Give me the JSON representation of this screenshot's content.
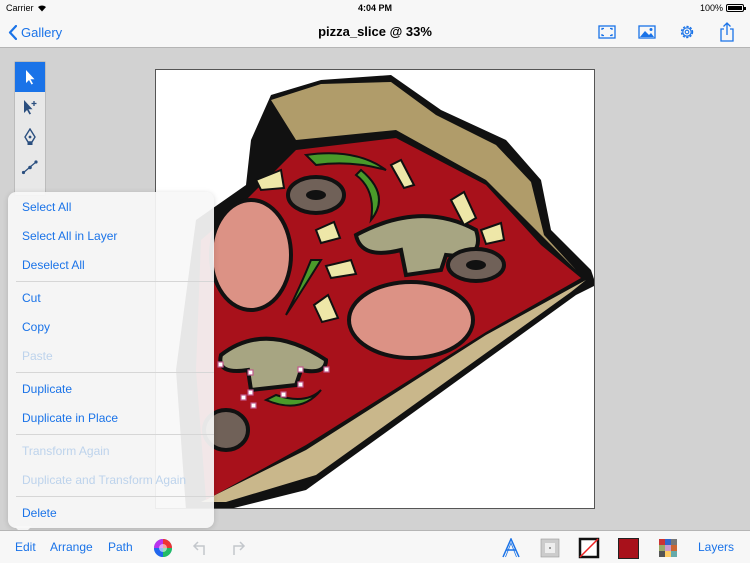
{
  "status_bar": {
    "carrier": "Carrier",
    "time": "4:04 PM",
    "battery": "100%"
  },
  "nav": {
    "back_label": "Gallery",
    "title": "pizza_slice @ 33%",
    "icons": [
      "fullscreen-icon",
      "image-icon",
      "settings-gear-icon",
      "share-icon"
    ]
  },
  "tools": [
    "select-arrow-icon",
    "direct-select-icon",
    "pen-icon",
    "node-edit-icon"
  ],
  "edit_menu": {
    "items": [
      {
        "label": "Select All",
        "enabled": true
      },
      {
        "label": "Select All in Layer",
        "enabled": true
      },
      {
        "label": "Deselect All",
        "enabled": true
      },
      {
        "label": "Cut",
        "enabled": true
      },
      {
        "label": "Copy",
        "enabled": true
      },
      {
        "label": "Paste",
        "enabled": false
      },
      {
        "label": "Duplicate",
        "enabled": true
      },
      {
        "label": "Duplicate in Place",
        "enabled": true
      },
      {
        "label": "Transform Again",
        "enabled": false
      },
      {
        "label": "Duplicate and Transform Again",
        "enabled": false
      },
      {
        "label": "Delete",
        "enabled": true
      }
    ]
  },
  "bottom_bar": {
    "edit_label": "Edit",
    "arrange_label": "Arrange",
    "path_label": "Path",
    "layers_label": "Layers",
    "fill_color": "#a8111b",
    "accent": "#1a73e8"
  }
}
